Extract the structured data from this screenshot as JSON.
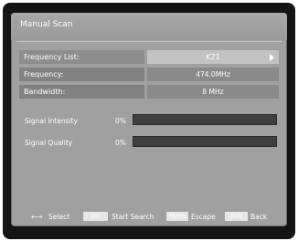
{
  "window": {
    "title": "Manual Scan"
  },
  "fields": [
    {
      "label": "Frequency List:",
      "value": "K21",
      "selected": true
    },
    {
      "label": "Frequency:",
      "value": "474.0MHz",
      "selected": false
    },
    {
      "label": "Bandwidth:",
      "value": "8 MHz",
      "selected": false
    }
  ],
  "signals": [
    {
      "label": "Signal Intensity",
      "percent_text": "0%",
      "level": 0
    },
    {
      "label": "Signal Quality",
      "percent_text": "0%",
      "level": 0
    }
  ],
  "footer": {
    "nav_arrows": "←→",
    "select_label": "Select",
    "ok_key": "OK",
    "start_search_label": "Start Search",
    "menu_key": "Menu",
    "escape_label": "Escape",
    "exit_key": "Exit",
    "back_label": "Back"
  },
  "colors": {
    "screen_bg": "#a0a0a0",
    "bezel": "#141414",
    "selected_value_bg": "#c2c2c2",
    "bar_bg": "#3f3f3f"
  }
}
